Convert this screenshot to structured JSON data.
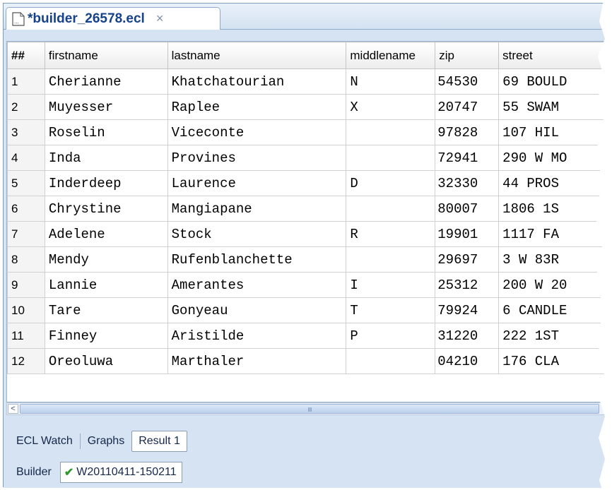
{
  "tab": {
    "title": "*builder_26578.ecl",
    "close": "×"
  },
  "grid": {
    "columns": [
      "##",
      "firstname",
      "lastname",
      "middlename",
      "zip",
      "street"
    ],
    "rows": [
      [
        "1",
        "Cherianne",
        "Khatchatourian",
        "N",
        "54530",
        "69 BOULD"
      ],
      [
        "2",
        "Muyesser",
        "Raplee",
        "X",
        "20747",
        "55 SWAM"
      ],
      [
        "3",
        "Roselin",
        "Viceconte",
        "",
        "97828",
        "107 HIL"
      ],
      [
        "4",
        "Inda",
        "Provines",
        "",
        "72941",
        "290 W MO"
      ],
      [
        "5",
        "Inderdeep",
        "Laurence",
        "D",
        "32330",
        "44 PROS"
      ],
      [
        "6",
        "Chrystine",
        "Mangiapane",
        "",
        "80007",
        "1806 1S"
      ],
      [
        "7",
        "Adelene",
        "Stock",
        "R",
        "19901",
        "1117 FA"
      ],
      [
        "8",
        "Mendy",
        "Rufenblanchette",
        "",
        "29697",
        "3 W 83R"
      ],
      [
        "9",
        "Lannie",
        "Amerantes",
        "I",
        "25312",
        "200 W 20"
      ],
      [
        "10",
        "Tare",
        "Gonyeau",
        "T",
        "79924",
        "6 CANDLE"
      ],
      [
        "11",
        "Finney",
        "Aristilde",
        "P",
        "31220",
        "222 1ST"
      ],
      [
        "12",
        "Oreoluwa",
        "Marthaler",
        "",
        "04210",
        "176 CLA"
      ]
    ]
  },
  "scrollbar": {
    "left_arrow": "<",
    "grip": "IIII"
  },
  "bottom": {
    "ecl_watch": "ECL Watch",
    "graphs": "Graphs",
    "result": "Result 1",
    "builder_label": "Builder",
    "workunit": "W20110411-150211"
  }
}
